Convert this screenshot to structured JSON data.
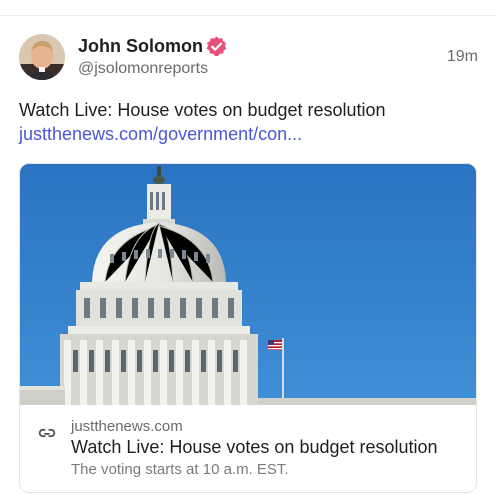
{
  "post": {
    "author_name": "John Solomon",
    "handle": "@jsolomonreports",
    "timestamp": "19m",
    "text": "Watch Live: House votes on budget resolution",
    "link_text": "justthenews.com/government/con..."
  },
  "card": {
    "domain": "justthenews.com",
    "title": "Watch Live: House votes on budget resolution",
    "description": "The voting starts at 10 a.m. EST."
  },
  "colors": {
    "verified_badge": "#e8507a",
    "link": "#4a57d6",
    "sky": "#2f7fc9"
  },
  "icons": {
    "verified": "verified-badge-icon",
    "link": "link-chain-icon"
  }
}
